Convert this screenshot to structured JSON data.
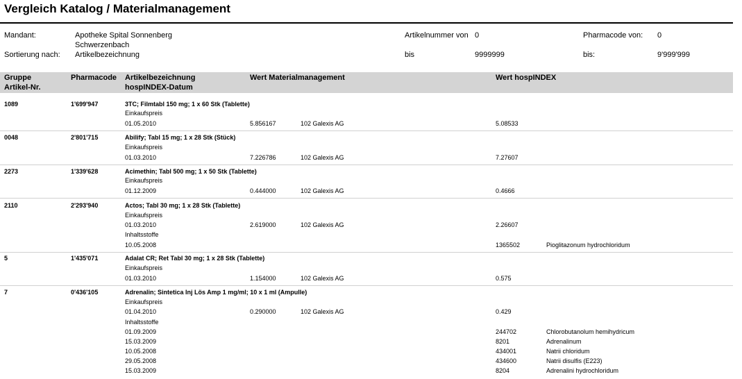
{
  "title": "Vergleich Katalog / Materialmanagement",
  "params": {
    "mandant_label": "Mandant:",
    "mandant_line1": "Apotheke Spital Sonnenberg",
    "mandant_line2": "Schwerzenbach",
    "sort_label": "Sortierung nach:",
    "sort_value": "Artikelbezeichnung",
    "artikel_von_label": "Artikelnummer von",
    "artikel_von_value": "0",
    "artikel_bis_label": "bis",
    "artikel_bis_value": "9999999",
    "pharma_von_label": "Pharmacode von:",
    "pharma_von_value": "0",
    "pharma_bis_label": "bis:",
    "pharma_bis_value": "9'999'999"
  },
  "columns": {
    "gruppe": "Gruppe",
    "artikel_nr": "Artikel-Nr.",
    "pharmacode": "Pharmacode",
    "artikelbezeichnung": "Artikelbezeichnung",
    "hospindex_datum": "hospINDEX-Datum",
    "wert_mm": "Wert Materialmanagement",
    "wert_hospindex": "Wert hospINDEX"
  },
  "records": {
    "r0": {
      "group": "1089",
      "pharmacode": "1'699'947",
      "name": "3TC; Filmtabl 150 mg; 1 x 60 Stk (Tablette)",
      "price_label": "Einkaufspreis",
      "price_date": "01.05.2010",
      "wert_mm": "5.856167",
      "supplier": "102 Galexis AG",
      "wert_hi": "5.08533"
    },
    "r1": {
      "group": "0048",
      "pharmacode": "2'801'715",
      "name": "Abilify; Tabl 15 mg; 1 x 28 Stk (Stück)",
      "price_label": "Einkaufspreis",
      "price_date": "01.03.2010",
      "wert_mm": "7.226786",
      "supplier": "102 Galexis AG",
      "wert_hi": "7.27607"
    },
    "r2": {
      "group": "2273",
      "pharmacode": "1'339'628",
      "name": "Acimethin; Tabl 500 mg; 1 x 50 Stk (Tablette)",
      "price_label": "Einkaufspreis",
      "price_date": "01.12.2009",
      "wert_mm": "0.444000",
      "supplier": "102 Galexis AG",
      "wert_hi": "0.4666"
    },
    "r3": {
      "group": "2110",
      "pharmacode": "2'293'940",
      "name": "Actos; Tabl 30 mg; 1 x 28 Stk (Tablette)",
      "price_label": "Einkaufspreis",
      "price_date": "01.03.2010",
      "wert_mm": "2.619000",
      "supplier": "102 Galexis AG",
      "wert_hi": "2.26607",
      "inh_label": "Inhaltsstoffe",
      "inh": [
        {
          "date": "10.05.2008",
          "code": "1365502",
          "name": "Pioglitazonum hydrochloridum"
        }
      ]
    },
    "r4": {
      "group": "5",
      "pharmacode": "1'435'071",
      "name": "Adalat CR; Ret Tabl 30 mg; 1 x 28 Stk (Tablette)",
      "price_label": "Einkaufspreis",
      "price_date": "01.03.2010",
      "wert_mm": "1.154000",
      "supplier": "102 Galexis AG",
      "wert_hi": "0.575"
    },
    "r5": {
      "group": "7",
      "pharmacode": "0'436'105",
      "name": "Adrenalin; Sintetica Inj Lös Amp 1 mg/ml; 10 x 1 ml (Ampulle)",
      "price_label": "Einkaufspreis",
      "price_date": "01.04.2010",
      "wert_mm": "0.290000",
      "supplier": "102 Galexis AG",
      "wert_hi": "0.429",
      "inh_label": "Inhaltsstoffe",
      "inh": [
        {
          "date": "01.09.2009",
          "code": "244702",
          "name": "Chlorobutanolum hemihydricum"
        },
        {
          "date": "15.03.2009",
          "code": "8201",
          "name": "Adrenalinum"
        },
        {
          "date": "10.05.2008",
          "code": "434001",
          "name": "Natrii chloridum"
        },
        {
          "date": "29.05.2008",
          "code": "434600",
          "name": "Natrii disulfis (E223)"
        },
        {
          "date": "15.03.2009",
          "code": "8204",
          "name": "Adrenalini hydrochloridum"
        }
      ]
    }
  }
}
